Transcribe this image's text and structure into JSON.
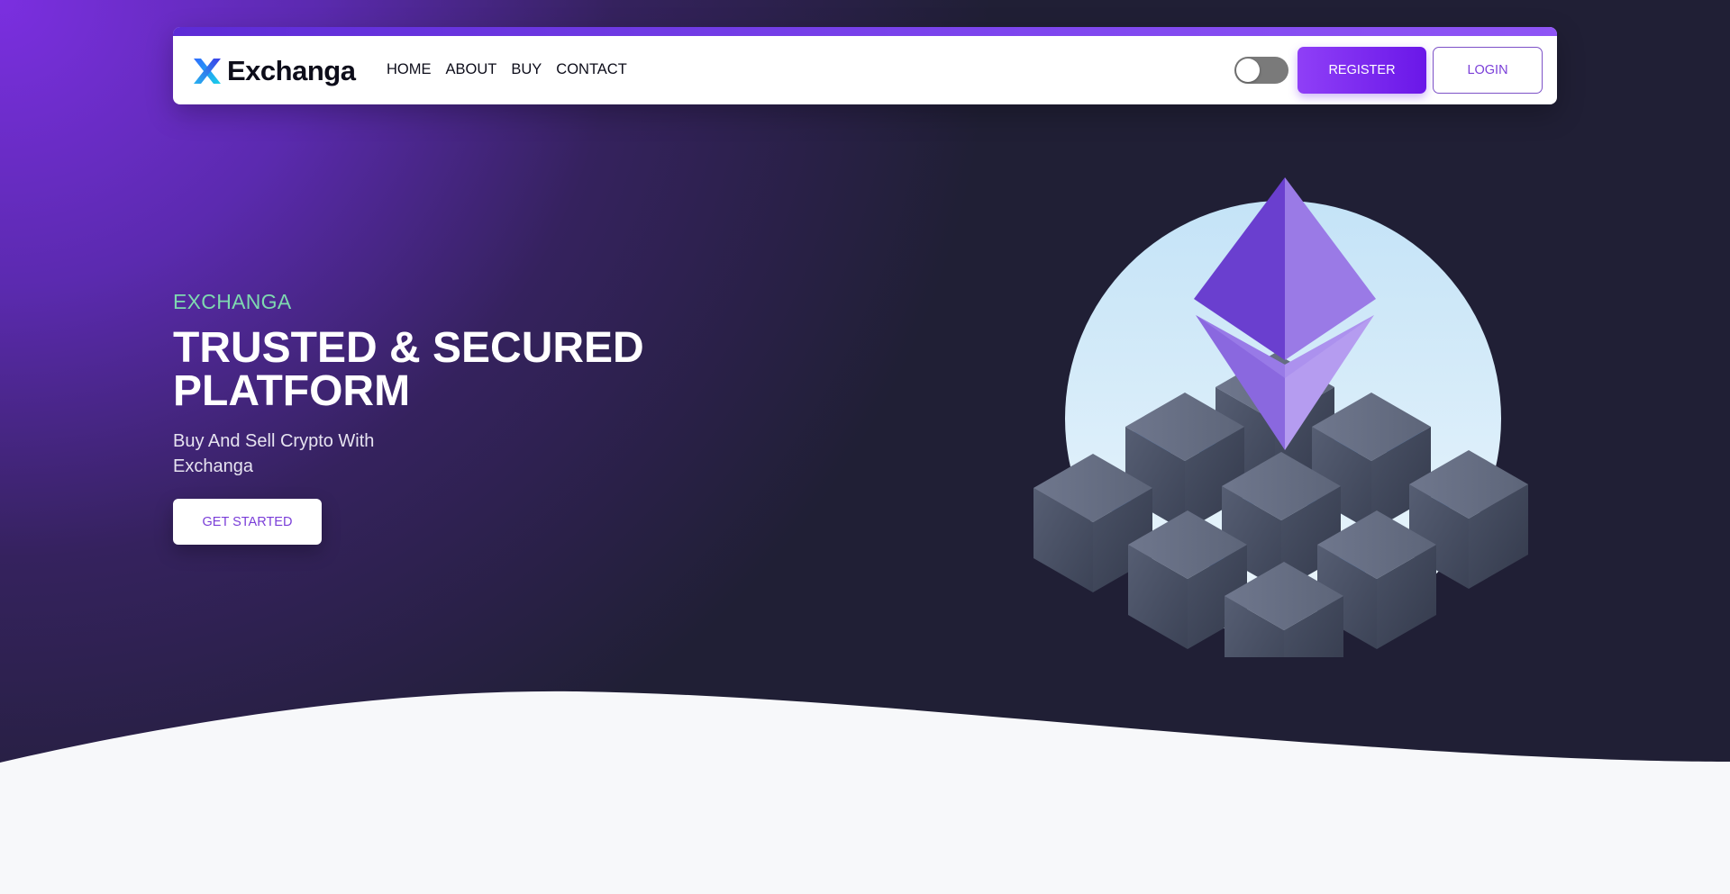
{
  "brand": {
    "name": "Exchanga",
    "icon": "x-logo-icon"
  },
  "nav": {
    "links": [
      {
        "label": "HOME"
      },
      {
        "label": "ABOUT"
      },
      {
        "label": "BUY"
      },
      {
        "label": "CONTACT"
      }
    ],
    "theme_toggle": {
      "state": "off"
    },
    "register_label": "REGISTER",
    "login_label": "LOGIN"
  },
  "hero": {
    "eyebrow": "EXCHANGA",
    "title": "TRUSTED & SECURED PLATFORM",
    "subtitle": "Buy And Sell Crypto With Exchanga",
    "cta_label": "GET STARTED",
    "illustration": "ethereum-blockchain-icon"
  },
  "colors": {
    "accent": "#7a3ed8",
    "eyebrow": "#7ed9b0",
    "dark_bg": "#201f35",
    "purple_bg": "#7b2fe0"
  }
}
